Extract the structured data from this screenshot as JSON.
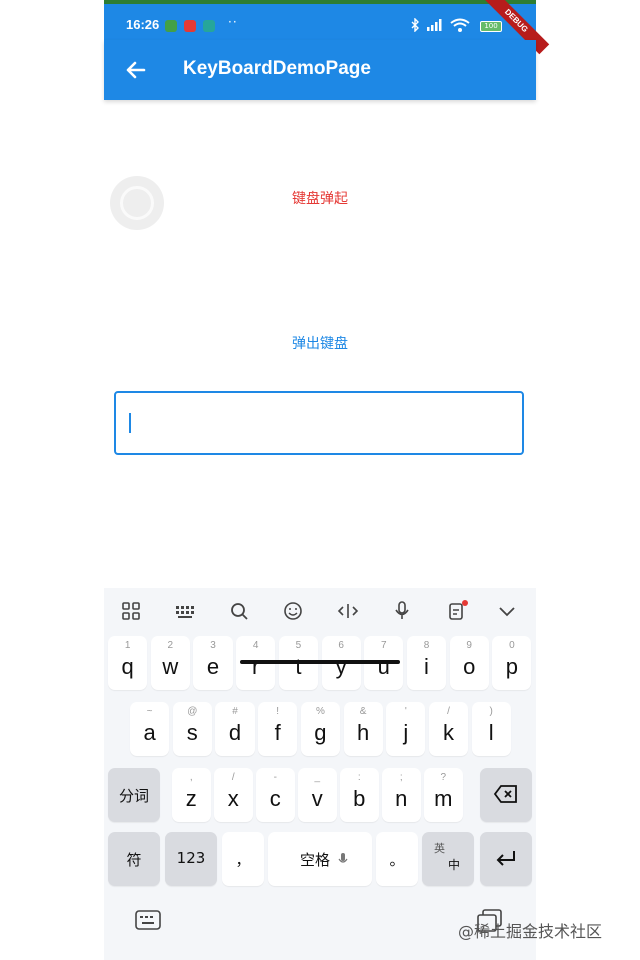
{
  "status_bar": {
    "time": "16:26",
    "more": "··",
    "battery": "100",
    "debug_banner": "DEBUG"
  },
  "app_bar": {
    "back_icon": "arrow-left-icon",
    "title": "KeyBoardDemoPage"
  },
  "content": {
    "status_label": "键盘弹起",
    "show_keyboard_button": "弹出键盘",
    "input_value": ""
  },
  "keyboard": {
    "toolbar": [
      "grid-icon",
      "keyboard-layout-icon",
      "search-icon",
      "emoji-icon",
      "cursor-icon",
      "microphone-icon",
      "clipboard-icon",
      "collapse-icon"
    ],
    "row1": [
      {
        "key": "q",
        "hint": "1"
      },
      {
        "key": "w",
        "hint": "2"
      },
      {
        "key": "e",
        "hint": "3"
      },
      {
        "key": "r",
        "hint": "4"
      },
      {
        "key": "t",
        "hint": "5"
      },
      {
        "key": "y",
        "hint": "6"
      },
      {
        "key": "u",
        "hint": "7"
      },
      {
        "key": "i",
        "hint": "8"
      },
      {
        "key": "o",
        "hint": "9"
      },
      {
        "key": "p",
        "hint": "0"
      }
    ],
    "row2": [
      {
        "key": "a",
        "hint": "~"
      },
      {
        "key": "s",
        "hint": "@"
      },
      {
        "key": "d",
        "hint": "#"
      },
      {
        "key": "f",
        "hint": "!"
      },
      {
        "key": "g",
        "hint": "%"
      },
      {
        "key": "h",
        "hint": "&"
      },
      {
        "key": "j",
        "hint": "'"
      },
      {
        "key": "k",
        "hint": "/"
      },
      {
        "key": "l",
        "hint": ")"
      }
    ],
    "row3": [
      {
        "key": "z",
        "hint": ","
      },
      {
        "key": "x",
        "hint": "/"
      },
      {
        "key": "c",
        "hint": "-"
      },
      {
        "key": "v",
        "hint": "_"
      },
      {
        "key": "b",
        "hint": ":"
      },
      {
        "key": "n",
        "hint": ";"
      },
      {
        "key": "m",
        "hint": "?"
      }
    ],
    "segment_key": "分词",
    "symbol_key": "符",
    "number_key": "123",
    "comma_key": "，",
    "space_key": "空格",
    "period_key": "。",
    "lang_key_top": "英",
    "lang_key_bottom": "中"
  },
  "watermark": "@稀土掘金技术社区"
}
